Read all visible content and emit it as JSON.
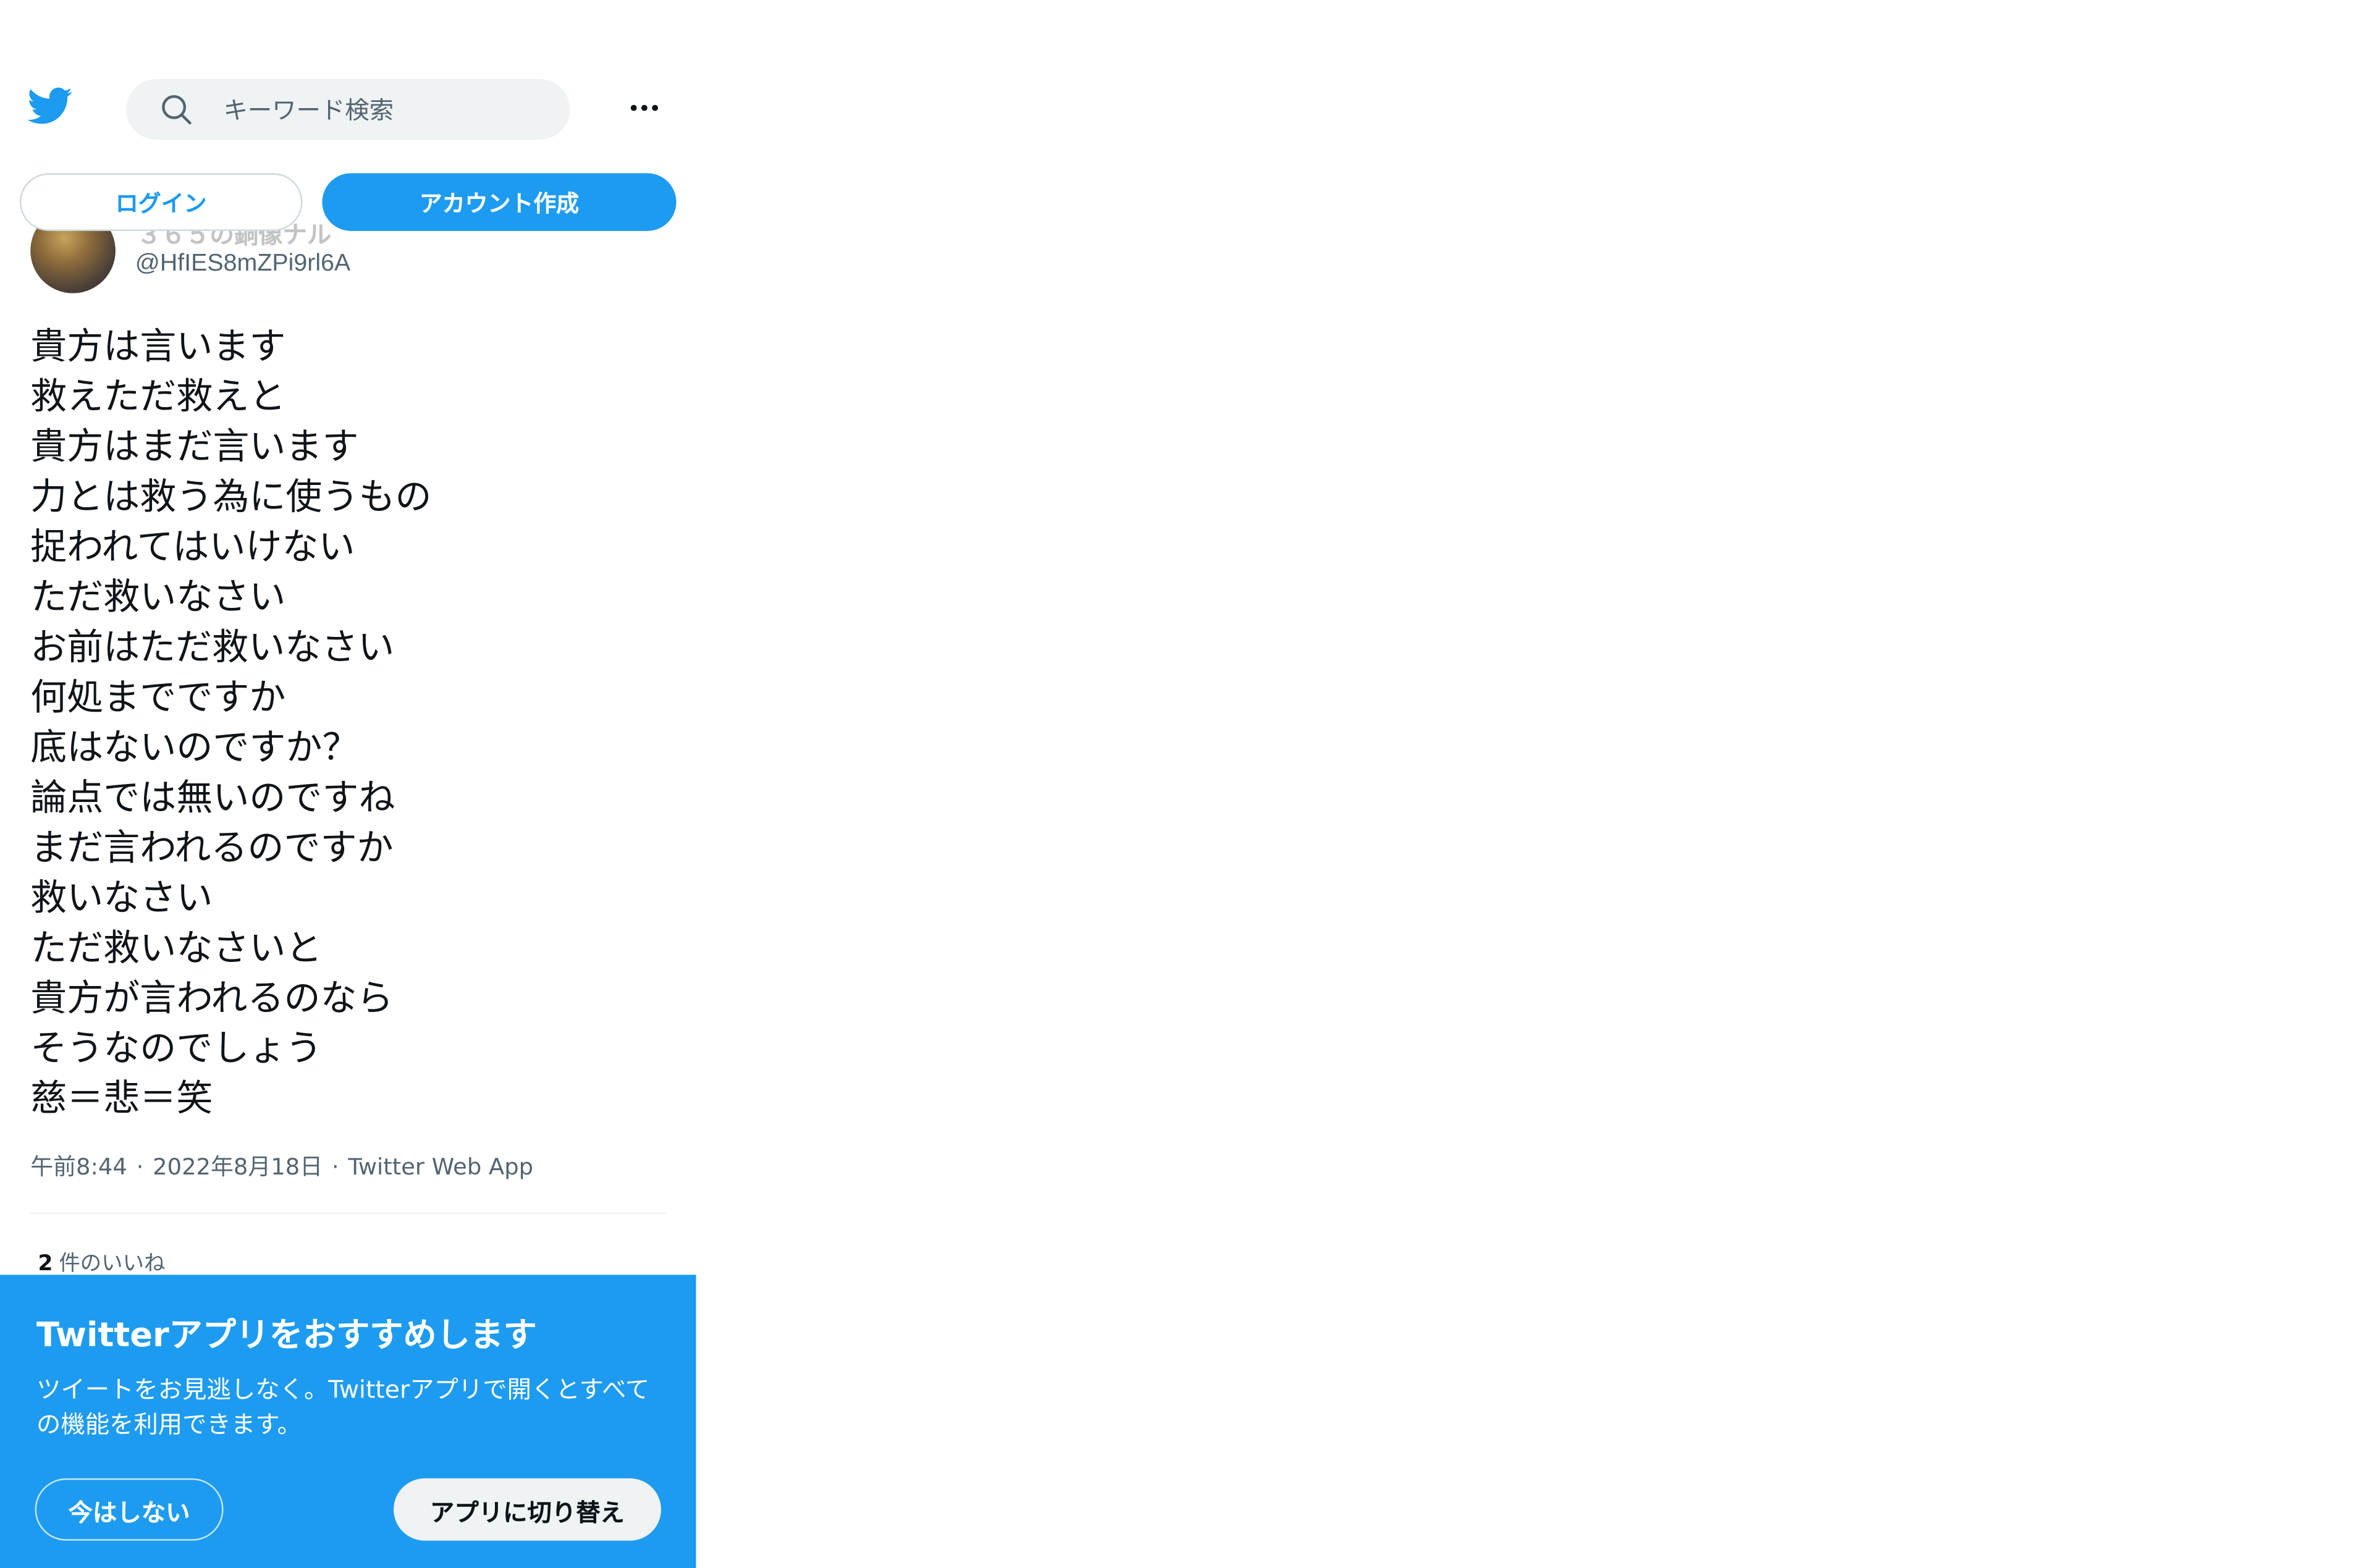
{
  "header": {
    "search_placeholder": "キーワード検索"
  },
  "auth": {
    "login_label": "ログイン",
    "signup_label": "アカウント作成"
  },
  "tweet": {
    "author_name": "３６５の銅像ナル",
    "author_handle": "@HfIES8mZPi9rl6A",
    "lines": [
      "貴方は言います",
      "救えただ救えと",
      "貴方はまだ言います",
      "力とは救う為に使うもの",
      "捉われてはいけない",
      "ただ救いなさい",
      "お前はただ救いなさい",
      "何処までですか",
      "底はないのですか？",
      "論点では無いのですね",
      "まだ言われるのですか",
      "救いなさい",
      "ただ救いなさいと",
      "貴方が言われるのなら",
      "そうなのでしょう",
      "慈＝悲＝笑"
    ],
    "time": "午前8:44",
    "date": "2022年8月18日",
    "source": "Twitter Web App",
    "separator": "·",
    "likes_count": "2",
    "likes_label": "件のいいね"
  },
  "banner": {
    "title": "Twitterアプリをおすすめします",
    "description": "ツイートをお見逃しなく。Twitterアプリで開くとすべての機能を利用できます。",
    "not_now_label": "今はしない",
    "switch_label": "アプリに切り替え"
  },
  "colors": {
    "brand": "#1d9bf0",
    "text": "#0f1419",
    "secondary": "#536471"
  }
}
